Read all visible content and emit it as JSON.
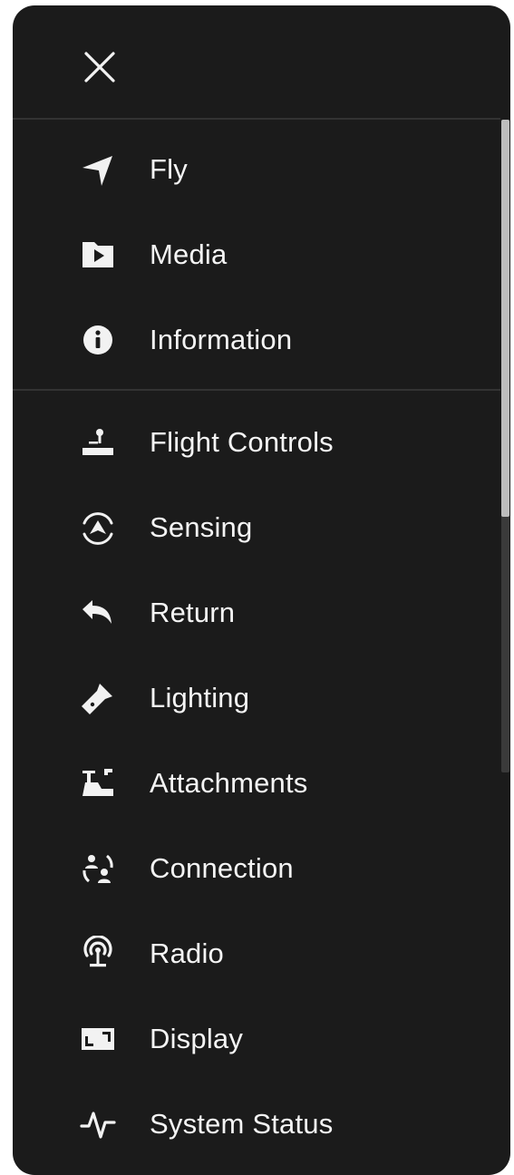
{
  "menu": {
    "close_icon": "close-icon",
    "primary_items": [
      {
        "label": "Fly",
        "icon": "navigation-arrow-icon"
      },
      {
        "label": "Media",
        "icon": "media-folder-icon"
      },
      {
        "label": "Information",
        "icon": "info-icon"
      }
    ],
    "settings_items": [
      {
        "label": "Flight Controls",
        "icon": "joystick-icon"
      },
      {
        "label": "Sensing",
        "icon": "sensing-icon"
      },
      {
        "label": "Return",
        "icon": "return-arrow-icon"
      },
      {
        "label": "Lighting",
        "icon": "flashlight-icon"
      },
      {
        "label": "Attachments",
        "icon": "attachment-icon"
      },
      {
        "label": "Connection",
        "icon": "connection-users-icon"
      },
      {
        "label": "Radio",
        "icon": "radio-antenna-icon"
      },
      {
        "label": "Display",
        "icon": "display-icon"
      },
      {
        "label": "System Status",
        "icon": "pulse-icon"
      }
    ]
  },
  "colors": {
    "panel_background": "#1b1b1b",
    "text": "#f4f4f4",
    "divider": "#333333",
    "page_background": "#ffffff"
  }
}
